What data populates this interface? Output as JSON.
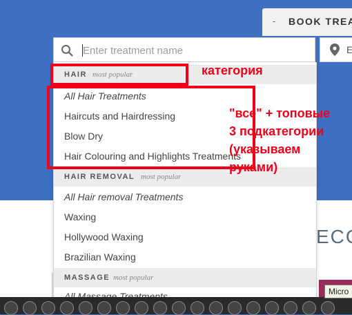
{
  "header": {
    "book_tab_dash": "-",
    "book_tab_label": "BOOK TREA"
  },
  "search": {
    "placeholder": "Enter treatment name",
    "value": "",
    "location_text": "E"
  },
  "dropdown": {
    "popular_label": "most popular",
    "categories": [
      {
        "name": "HAIR",
        "items": [
          "All Hair Treatments",
          "Haircuts and Hairdressing",
          "Blow Dry",
          "Hair Colouring and Highlights Treatments"
        ]
      },
      {
        "name": "HAIR REMOVAL",
        "items": [
          "All Hair removal Treatments",
          "Waxing",
          "Hollywood Waxing",
          "Brazilian Waxing"
        ]
      },
      {
        "name": "MASSAGE",
        "items": [
          "All Massage Treatments"
        ]
      }
    ]
  },
  "background": {
    "eco_text": "ECO",
    "tooltip_text": "Micro"
  },
  "annotations": {
    "category_label": "категория",
    "subcategory_note": [
      "\"все\" + топовые",
      "3 подкатегории",
      "(указываем",
      "руками)"
    ]
  },
  "colors": {
    "background_blue": "#3f6fc1",
    "annotation_red": "#f2001a",
    "category_header_bg": "#ececec"
  }
}
